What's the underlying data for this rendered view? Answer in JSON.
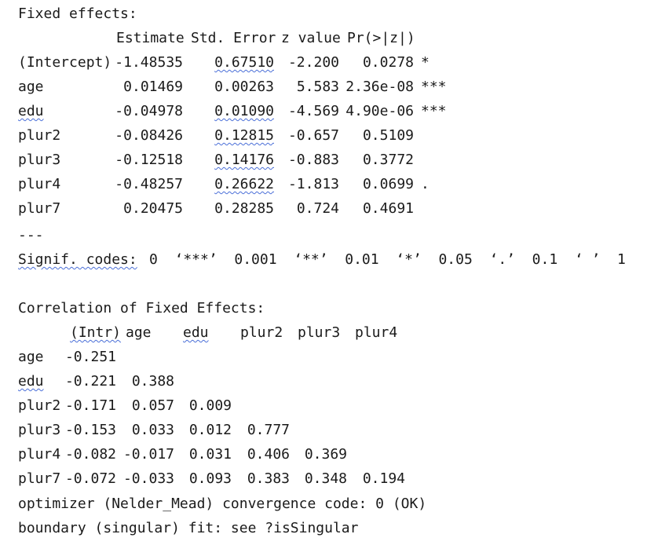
{
  "fixed_effects": {
    "title": "Fixed effects:",
    "headers": [
      "Estimate",
      "Std. Error",
      "z value",
      "Pr(>|z|)"
    ],
    "rows": [
      {
        "term": "(Intercept)",
        "estimate": "-1.48535",
        "std_error": "0.67510",
        "z": "-2.200",
        "p": "0.0278",
        "sig": "*"
      },
      {
        "term": "age",
        "estimate": "0.01469",
        "std_error": "0.00263",
        "z": "5.583",
        "p": "2.36e-08",
        "sig": "***"
      },
      {
        "term": "edu",
        "estimate": "-0.04978",
        "std_error": "0.01090",
        "z": "-4.569",
        "p": "4.90e-06",
        "sig": "***"
      },
      {
        "term": "plur2",
        "estimate": "-0.08426",
        "std_error": "0.12815",
        "z": "-0.657",
        "p": "0.5109",
        "sig": ""
      },
      {
        "term": "plur3",
        "estimate": "-0.12518",
        "std_error": "0.14176",
        "z": "-0.883",
        "p": "0.3772",
        "sig": ""
      },
      {
        "term": "plur4",
        "estimate": "-0.48257",
        "std_error": "0.26622",
        "z": "-1.813",
        "p": "0.0699",
        "sig": "."
      },
      {
        "term": "plur7",
        "estimate": "0.20475",
        "std_error": "0.28285",
        "z": "0.724",
        "p": "0.4691",
        "sig": ""
      }
    ],
    "separator": "---"
  },
  "signif": {
    "label": "Signif. codes:",
    "codes": "0  ‘***’  0.001  ‘**’  0.01  ‘*’  0.05  ‘.’  0.1  ‘ ’  1"
  },
  "correlation": {
    "title": "Correlation of Fixed Effects:",
    "headers": [
      "(Intr)",
      "age",
      "edu",
      "plur2",
      "plur3",
      "plur4"
    ],
    "rows": [
      {
        "term": "age",
        "values": [
          "-0.251"
        ]
      },
      {
        "term": "edu",
        "values": [
          "-0.221",
          "0.388"
        ]
      },
      {
        "term": "plur2",
        "values": [
          "-0.171",
          "0.057",
          "0.009"
        ]
      },
      {
        "term": "plur3",
        "values": [
          "-0.153",
          "0.033",
          "0.012",
          "0.777"
        ]
      },
      {
        "term": "plur4",
        "values": [
          "-0.082",
          "-0.017",
          "0.031",
          "0.406",
          "0.369"
        ]
      },
      {
        "term": "plur7",
        "values": [
          "-0.072",
          "-0.033",
          "0.093",
          "0.383",
          "0.348",
          "0.194"
        ]
      }
    ]
  },
  "footer": {
    "optimizer": "optimizer (Nelder_Mead) convergence code: 0 (OK)",
    "boundary": "boundary (singular) fit: see ?isSingular"
  }
}
